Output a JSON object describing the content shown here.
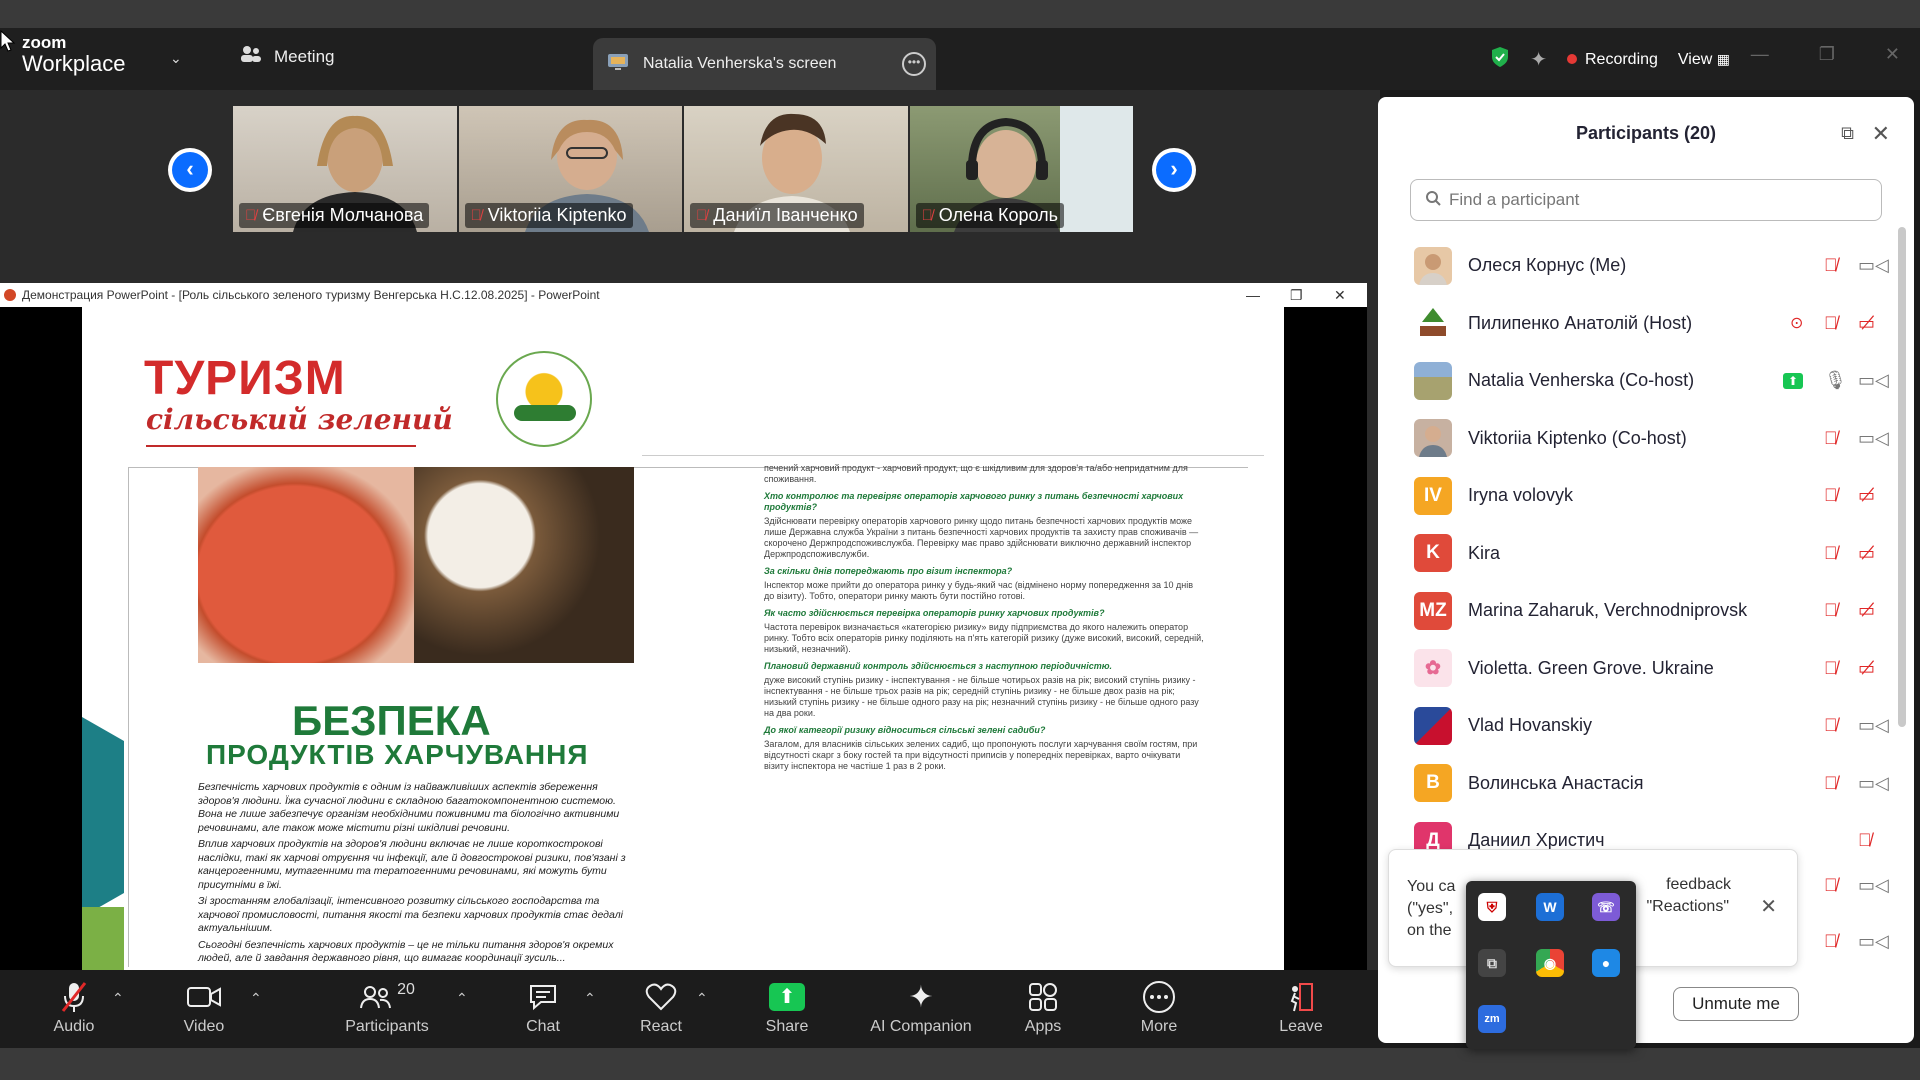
{
  "app": {
    "brand_top": "zoom",
    "brand_bottom": "Workplace",
    "meeting_label": "Meeting",
    "screen_tab_label": "Natalia Venherska's screen",
    "recording_label": "Recording",
    "view_label": "View"
  },
  "gallery": [
    {
      "name": "Євгенія Молчанова"
    },
    {
      "name": "Viktoriia Kiptenko"
    },
    {
      "name": "Даниїл Іванченко"
    },
    {
      "name": "Олена Король"
    }
  ],
  "ppt": {
    "window_title": "Демонстрация PowerPoint - [Роль сільського зеленого туризму Венгерська Н.С.12.08.2025] - PowerPoint",
    "slide": {
      "heading": "ТУРИЗМ",
      "subheading": "сільський зелений",
      "title1": "БЕЗПЕКА",
      "title2": "ПРОДУКТІВ ХАРЧУВАННЯ",
      "left_paragraphs": [
        "Безпечність харчових продуктів є одним із найважливіших аспектів збереження здоров'я людини. Їжа сучасної людини є складною багатокомпонентною системою. Вона не лише забезпечує організм необхідними поживними та біологічно активними речовинами, але також може містити різні шкідливі речовини.",
        "Вплив харчових продуктів на здоров'я людини включає не лише короткострокові наслідки, такі як харчові отруєння чи інфекції, але й довгострокові ризики, пов'язані з канцерогенними, мутагенними та тератогенними речовинами, які можуть бути присутніми в їжі.",
        "Зі зростанням глобалізації, інтенсивного розвитку сільського господарства та харчової промисловості, питання якості та безпеки харчових продуктів стає дедалі актуальнішим.",
        "Сьогодні безпечність харчових продуктів – це не тільки питання здоров'я окремих людей, але й завдання державного рівня, що вимагає координації зусиль..."
      ],
      "right_blocks": [
        {
          "q": "",
          "t": "печений харчовий продукт - харчовий продукт, що є шкідливим для здоров'я та/або непридатним для споживання."
        },
        {
          "q": "Хто контролює та перевіряє операторів харчового ринку з питань безпечності харчових продуктів?",
          "t": "Здійснювати перевірку операторів харчового ринку щодо питань безпечності харчових продуктів може лише Державна служба України з питань безпечності харчових продуктів та захисту прав споживачів — скорочено Держпродспоживслужба. Перевірку має право здійснювати виключно державний інспектор Держпродспоживслужби."
        },
        {
          "q": "За скільки днів попереджають про візит інспектора?",
          "t": "Інспектор може прийти до оператора ринку у будь-який час (відмінено норму попередження за 10 днів до візиту). Тобто, оператори ринку мають бути постійно готові."
        },
        {
          "q": "Як часто здійснюється перевірка операторів ринку харчових продуктів?",
          "t": "Частота перевірок визначається «категорією ризику» виду підприємства до якого належить оператор ринку. Тобто всіх операторів ринку поділяють на п'ять категорій ризику (дуже високий, високий, середній, низький, незначний)."
        },
        {
          "q": "Плановий державний контроль здійснюється з наступною періодичністю.",
          "t": "дуже високий ступінь ризику - інспектування - не більше чотирьох разів на рік; високий ступінь ризику - інспектування - не більше трьох разів на рік; середній ступінь ризику - не більше двох разів на рік; низький ступінь ризику - не більше одного разу на рік; незначний ступінь ризику - не більше одного разу на два роки."
        },
        {
          "q": "До якої категорії ризику відноситься сільські зелені садиби?",
          "t": "Загалом, для власників сільських зелених садиб, що пропонують послуги харчування своїм гостям, при відсутності скарг з боку гостей та при відсутності приписів у попередніх перевірках, варто очікувати візиту інспектора не частіше 1 раз в 2 роки."
        }
      ]
    }
  },
  "toolbar": {
    "audio": "Audio",
    "video": "Video",
    "participants": "Participants",
    "participants_count": "20",
    "chat": "Chat",
    "react": "React",
    "share": "Share",
    "ai": "AI Companion",
    "apps": "Apps",
    "more": "More",
    "leave": "Leave"
  },
  "panel": {
    "title": "Participants (20)",
    "search_placeholder": "Find a participant",
    "participants": [
      {
        "name": "Олеся Корнус (Me)",
        "avatar": "",
        "avatar_color": "#d9b48f"
      },
      {
        "name": "Пилипенко Анатолій (Host)",
        "avatar": "",
        "avatar_color": "#5b8c3a"
      },
      {
        "name": "Natalia Venherska (Co-host)",
        "avatar": "",
        "avatar_color": "#8f9d7a"
      },
      {
        "name": "Viktoriia Kiptenko (Co-host)",
        "avatar": "",
        "avatar_color": "#b88c7a"
      },
      {
        "name": "Iryna volovyk",
        "avatar": "IV",
        "avatar_color": "#f5a623"
      },
      {
        "name": "Kira",
        "avatar": "K",
        "avatar_color": "#e04a3a"
      },
      {
        "name": "Marina Zaharuk, Verchnodniprovsk",
        "avatar": "MZ",
        "avatar_color": "#e04a3a"
      },
      {
        "name": "Violetta. Green Grove. Ukraine",
        "avatar": "",
        "avatar_color": "#f7d6e0"
      },
      {
        "name": "Vlad Hovanskiy",
        "avatar": "",
        "avatar_color": "#3b5998"
      },
      {
        "name": "Волинська Анастасія",
        "avatar": "B",
        "avatar_color": "#f5a623"
      },
      {
        "name": "Даниил Христич",
        "avatar": "Д",
        "avatar_color": "#e0356b"
      }
    ],
    "toast_left": "You ca",
    "toast_left2": "(\"yes\",",
    "toast_left3": "on the",
    "toast_right1": "feedback",
    "toast_right2": "\"Reactions\"",
    "unmute": "Unmute me"
  },
  "colors": {
    "accent_blue": "#0b6cff",
    "mic_off_red": "#e02828",
    "share_green": "#17c653"
  }
}
